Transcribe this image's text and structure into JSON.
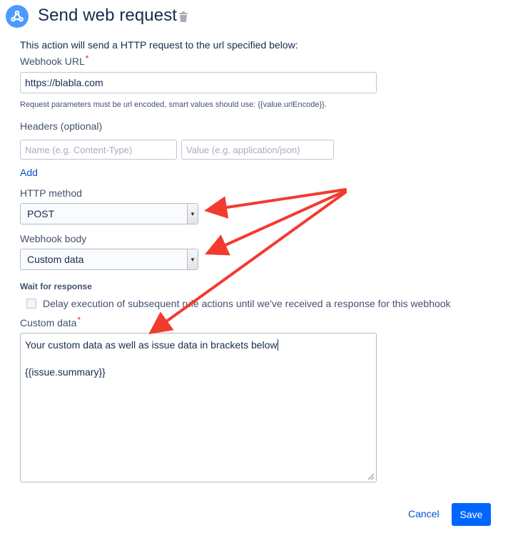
{
  "header": {
    "title": "Send web request",
    "icon": "webhook-icon",
    "delete_icon": "trash-icon"
  },
  "description": "This action will send a HTTP request to the url specified below:",
  "webhook_url": {
    "label": "Webhook URL",
    "required_mark": "*",
    "value": "https://blabla.com",
    "help": "Request parameters must be url encoded, smart values should use: {{value.urlEncode}}."
  },
  "headers": {
    "label": "Headers (optional)",
    "name_placeholder": "Name (e.g. Content-Type)",
    "value_placeholder": "Value (e.g. application/json)",
    "add_label": "Add"
  },
  "http_method": {
    "label": "HTTP method",
    "selected": "POST"
  },
  "webhook_body": {
    "label": "Webhook body",
    "selected": "Custom data"
  },
  "wait": {
    "label": "Wait for response",
    "checkbox_label": "Delay execution of subsequent rule actions until we've received a response for this webhook",
    "checked": false
  },
  "custom_data": {
    "label": "Custom data",
    "required_mark": "*",
    "line1": "Your custom data as well as issue data in brackets below",
    "line2": "{{issue.summary}}"
  },
  "footer": {
    "cancel_label": "Cancel",
    "save_label": "Save"
  },
  "colors": {
    "primary": "#0065ff",
    "link": "#0052cc",
    "annotation_arrow": "#f23b2f",
    "required": "#de350b"
  }
}
